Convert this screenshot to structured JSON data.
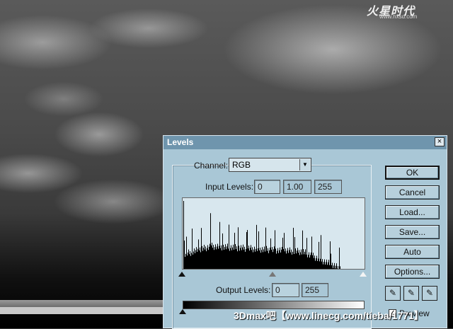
{
  "logo": {
    "main": "火星时代",
    "sub": "www.hxsd.com"
  },
  "dialog": {
    "title": "Levels",
    "close_glyph": "×",
    "channel_label": "Channel:",
    "channel_value": "RGB",
    "input_levels_label": "Input Levels:",
    "input_levels": [
      "0",
      "1.00",
      "255"
    ],
    "output_levels_label": "Output Levels:",
    "output_levels": [
      "0",
      "255"
    ],
    "buttons": {
      "ok": "OK",
      "cancel": "Cancel",
      "load": "Load...",
      "save": "Save...",
      "auto": "Auto",
      "options": "Options..."
    },
    "eyedroppers": [
      "black-eyedropper-icon",
      "gray-eyedropper-icon",
      "white-eyedropper-icon"
    ],
    "preview_label": "Preview",
    "preview_checked": true
  },
  "watermark": "3Dmax吧【www.linecg.com/tieba/1771】"
}
